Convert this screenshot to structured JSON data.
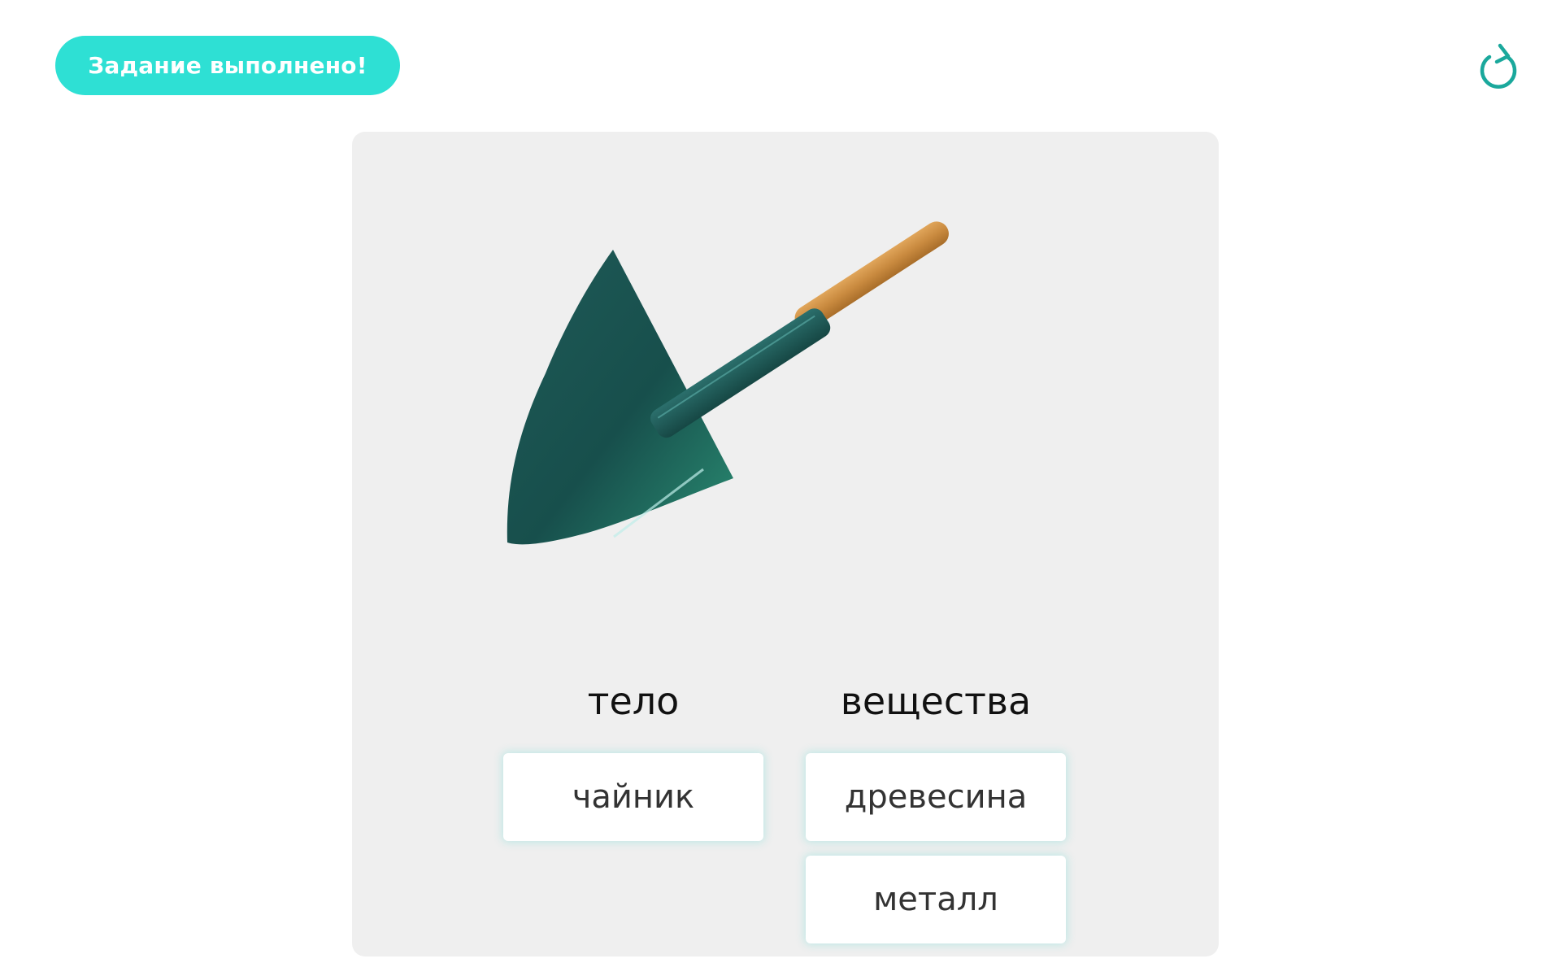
{
  "header": {
    "status_label": "Задание выполнено!",
    "reload_icon": "reload-icon"
  },
  "colors": {
    "accent": "#2ee0d4",
    "card_background": "#efefef",
    "tile_glow": "#8ce1dc",
    "reload_icon": "#1aa89c"
  },
  "illustration": {
    "icon": "shovel-icon"
  },
  "columns": [
    {
      "heading": "тело",
      "items": [
        "чайник"
      ]
    },
    {
      "heading": "вещества",
      "items": [
        "древесина",
        "металл"
      ]
    }
  ]
}
